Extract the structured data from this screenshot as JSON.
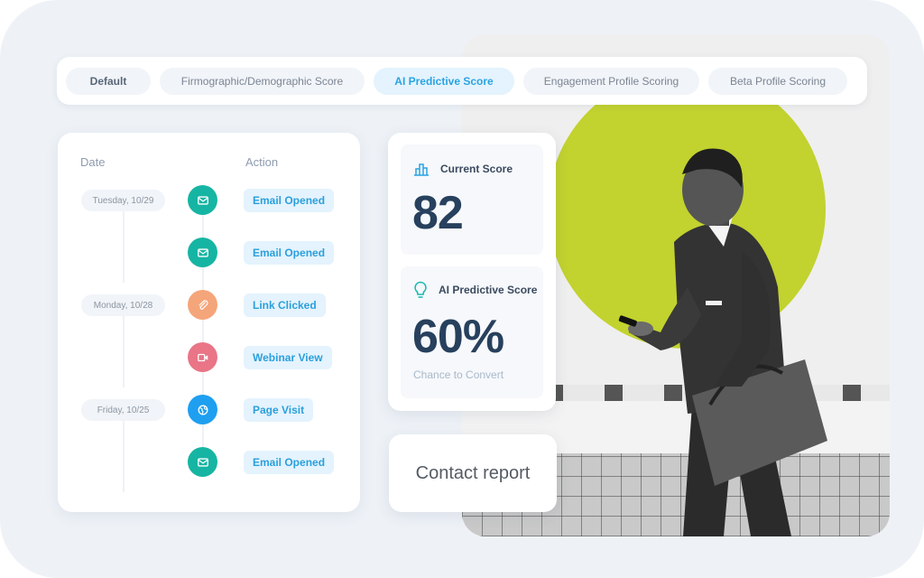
{
  "colors": {
    "lime": "#c2d22f",
    "teal": "#16b5a3",
    "orange": "#f5a57a",
    "pink": "#e97587",
    "blue": "#1e9ff0",
    "accent": "#2aa3e2",
    "score_text": "#27405d"
  },
  "tabs": [
    {
      "label": "Default",
      "state": "default-bold"
    },
    {
      "label": "Firmographic/Demographic Score",
      "state": "default"
    },
    {
      "label": "AI Predictive Score",
      "state": "active"
    },
    {
      "label": "Engagement Profile Scoring",
      "state": "default"
    },
    {
      "label": "Beta Profile Scoring",
      "state": "default"
    }
  ],
  "timeline": {
    "date_header": "Date",
    "action_header": "Action",
    "dates": [
      "Tuesday, 10/29",
      "Monday, 10/28",
      "Friday, 10/25"
    ],
    "events": [
      {
        "label": "Email Opened",
        "icon": "envelope-icon",
        "color": "teal"
      },
      {
        "label": "Email Opened",
        "icon": "envelope-icon",
        "color": "teal"
      },
      {
        "label": "Link Clicked",
        "icon": "paperclip-icon",
        "color": "orange"
      },
      {
        "label": "Webinar View",
        "icon": "video-camera-icon",
        "color": "pink"
      },
      {
        "label": "Page Visit",
        "icon": "globe-icon",
        "color": "blue"
      },
      {
        "label": "Email Opened",
        "icon": "envelope-icon",
        "color": "teal"
      }
    ]
  },
  "scores": {
    "current": {
      "label": "Current Score",
      "value": "82",
      "icon": "bar-chart-icon"
    },
    "predictive": {
      "label": "AI Predictive Score",
      "value": "60%",
      "caption": "Chance to Convert",
      "icon": "lightbulb-icon"
    }
  },
  "contact_report": {
    "label": "Contact report"
  }
}
